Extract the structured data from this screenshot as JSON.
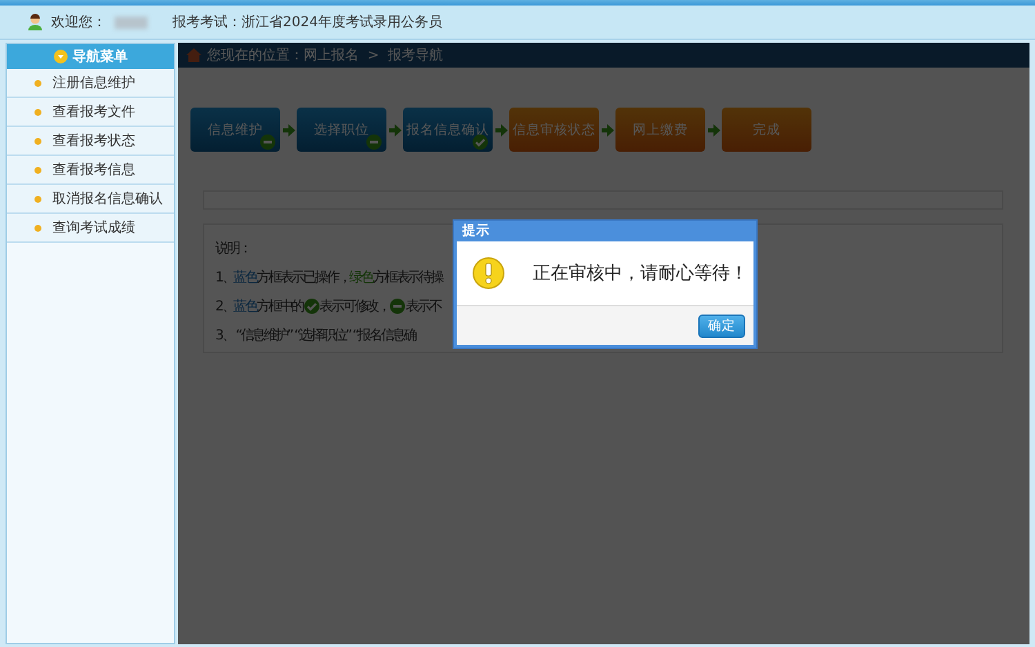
{
  "header": {
    "welcome": "欢迎您：",
    "exam": "报考考试：浙江省2024年度考试录用公务员"
  },
  "sidebar": {
    "title": "导航菜单",
    "items": [
      {
        "label": "注册信息维护"
      },
      {
        "label": "查看报考文件"
      },
      {
        "label": "查看报考状态"
      },
      {
        "label": "查看报考信息"
      },
      {
        "label": "取消报名信息确认"
      },
      {
        "label": "查询考试成绩"
      }
    ]
  },
  "breadcrumb": {
    "text": "您现在的位置：网上报名  >  报考导航"
  },
  "steps": [
    {
      "label": "信息维护",
      "kind": "locked"
    },
    {
      "label": "选择职位",
      "kind": "locked"
    },
    {
      "label": "报名信息确认",
      "kind": "editable"
    },
    {
      "label": "信息审核状态",
      "kind": "pending"
    },
    {
      "label": "网上缴费",
      "kind": "pending"
    },
    {
      "label": "完成",
      "kind": "pending"
    }
  ],
  "notes": {
    "title": "说明：",
    "lines": [
      [
        {
          "kind": "text",
          "text": "1、"
        },
        {
          "kind": "done",
          "text": "蓝色"
        },
        {
          "kind": "text",
          "text": "方框表示已操作，"
        },
        {
          "kind": "pending",
          "text": "绿色"
        },
        {
          "kind": "text",
          "text": "方框表示待操"
        }
      ],
      [
        {
          "kind": "text",
          "text": "2、"
        },
        {
          "kind": "done",
          "text": "蓝色"
        },
        {
          "kind": "text",
          "text": "方框中的"
        },
        {
          "kind": "check"
        },
        {
          "kind": "text",
          "text": "表示可修改，"
        },
        {
          "kind": "minus"
        },
        {
          "kind": "text",
          "text": "表示不"
        }
      ],
      [
        {
          "kind": "text",
          "text": "3、 “信息维护” “选择职位” “报名信息确"
        }
      ]
    ]
  },
  "dialog": {
    "title": "提示",
    "message": "正在审核中，请耐心等待！",
    "button": "确定"
  }
}
